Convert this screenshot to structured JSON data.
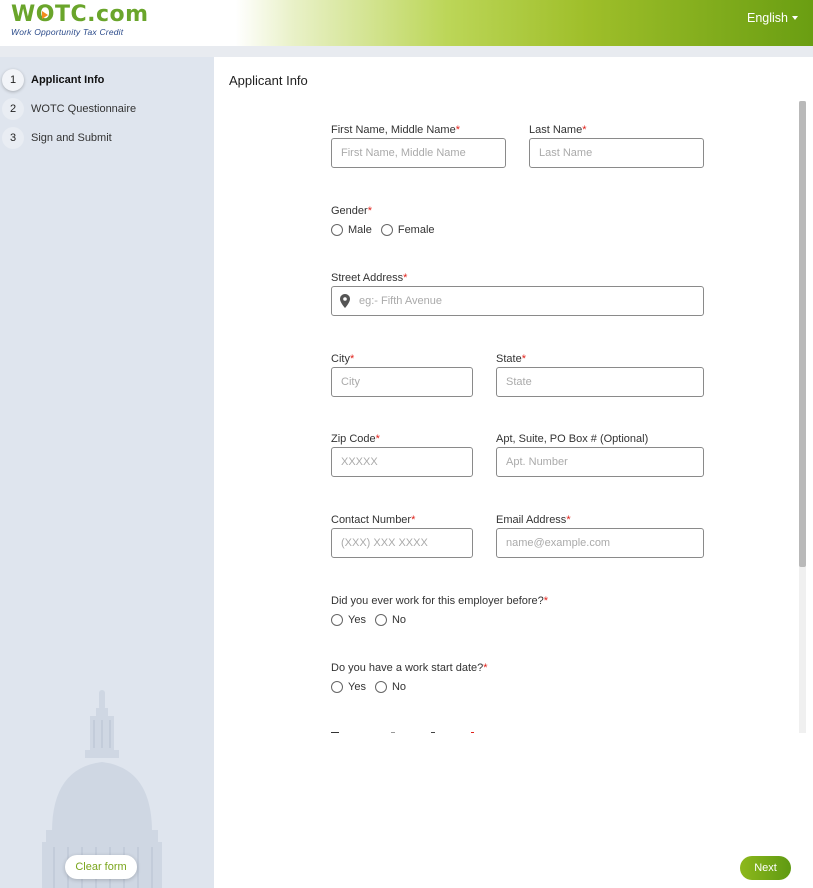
{
  "header": {
    "logo_text_pre": "W",
    "logo_text_post": "TC.com",
    "logo_subtitle": "Work Opportunity Tax Credit",
    "language": "English",
    "brand_green": "#6aa52b",
    "accent_green": "#7aa51c"
  },
  "sidebar": {
    "steps": [
      {
        "number": "1",
        "label": "Applicant Info",
        "active": true
      },
      {
        "number": "2",
        "label": "WOTC Questionnaire",
        "active": false
      },
      {
        "number": "3",
        "label": "Sign and Submit",
        "active": false
      }
    ],
    "clear_label": "Clear form"
  },
  "main": {
    "title": "Applicant Info",
    "required_mark": "*",
    "fields": {
      "first_name": {
        "label": "First Name, Middle Name",
        "placeholder": "First Name, Middle Name",
        "value": ""
      },
      "last_name": {
        "label": "Last Name",
        "placeholder": "Last Name",
        "value": ""
      },
      "gender": {
        "label": "Gender",
        "options": [
          "Male",
          "Female"
        ],
        "selected": null
      },
      "street": {
        "label": "Street Address",
        "placeholder": "eg:- Fifth Avenue",
        "value": ""
      },
      "city": {
        "label": "City",
        "placeholder": "City",
        "value": ""
      },
      "state": {
        "label": "State",
        "placeholder": "State",
        "value": ""
      },
      "zip": {
        "label": "Zip Code",
        "placeholder": "XXXXX",
        "value": ""
      },
      "apt": {
        "label": "Apt, Suite, PO Box # (Optional)",
        "placeholder": "Apt. Number",
        "value": ""
      },
      "contact": {
        "label": "Contact Number",
        "placeholder": "(XXX) XXX XXXX",
        "value": ""
      },
      "email": {
        "label": "Email Address",
        "placeholder": "name@example.com",
        "value": ""
      },
      "worked_before": {
        "label": "Did you ever work for this employer before?",
        "options": [
          "Yes",
          "No"
        ],
        "selected": null
      },
      "start_date": {
        "label": "Do you have a work start date?",
        "options": [
          "Yes",
          "No"
        ],
        "selected": null
      }
    },
    "next_label": "Next"
  }
}
